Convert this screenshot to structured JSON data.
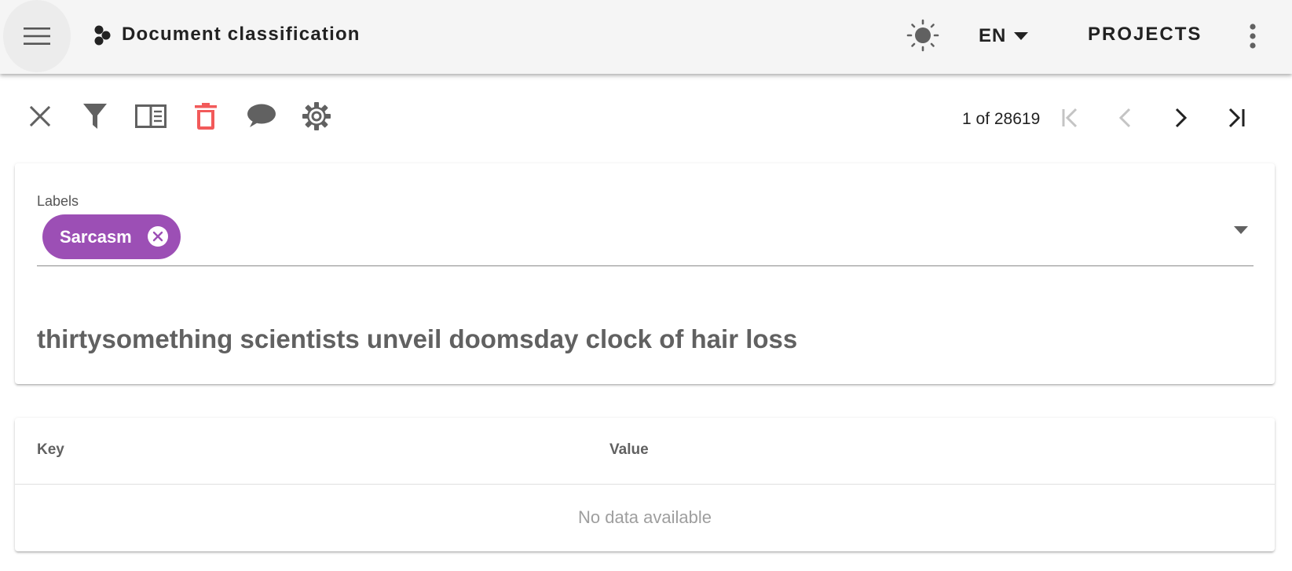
{
  "appbar": {
    "title": "Document classification",
    "language": "EN",
    "projects_label": "PROJECTS"
  },
  "icons": {
    "menu": "hamburger-menu-icon",
    "logo": "hexagon-cluster-icon",
    "theme": "brightness-icon",
    "language_caret": "caret-down-icon",
    "more": "dots-vertical-icon",
    "close": "close-icon",
    "filter": "filter-icon",
    "layout": "book-open-icon",
    "delete": "trash-icon",
    "comment": "comment-icon",
    "settings": "gear-icon",
    "first": "page-first-icon",
    "prev": "chevron-left-icon",
    "next": "chevron-right-icon",
    "last": "page-last-icon"
  },
  "pager": {
    "text": "1 of 28619"
  },
  "labels": {
    "caption": "Labels",
    "selected": [
      {
        "text": "Sarcasm",
        "color": "#9c4fb5"
      }
    ]
  },
  "document": {
    "text": "thirtysomething scientists unveil doomsday clock of hair loss"
  },
  "metadata_table": {
    "headers": [
      "Key",
      "Value"
    ],
    "empty_text": "No data available"
  },
  "colors": {
    "appbar_bg": "#f5f5f5",
    "icon_gray": "#616161",
    "delete_red": "#f25a5a",
    "chip_purple": "#9c4fb5"
  }
}
